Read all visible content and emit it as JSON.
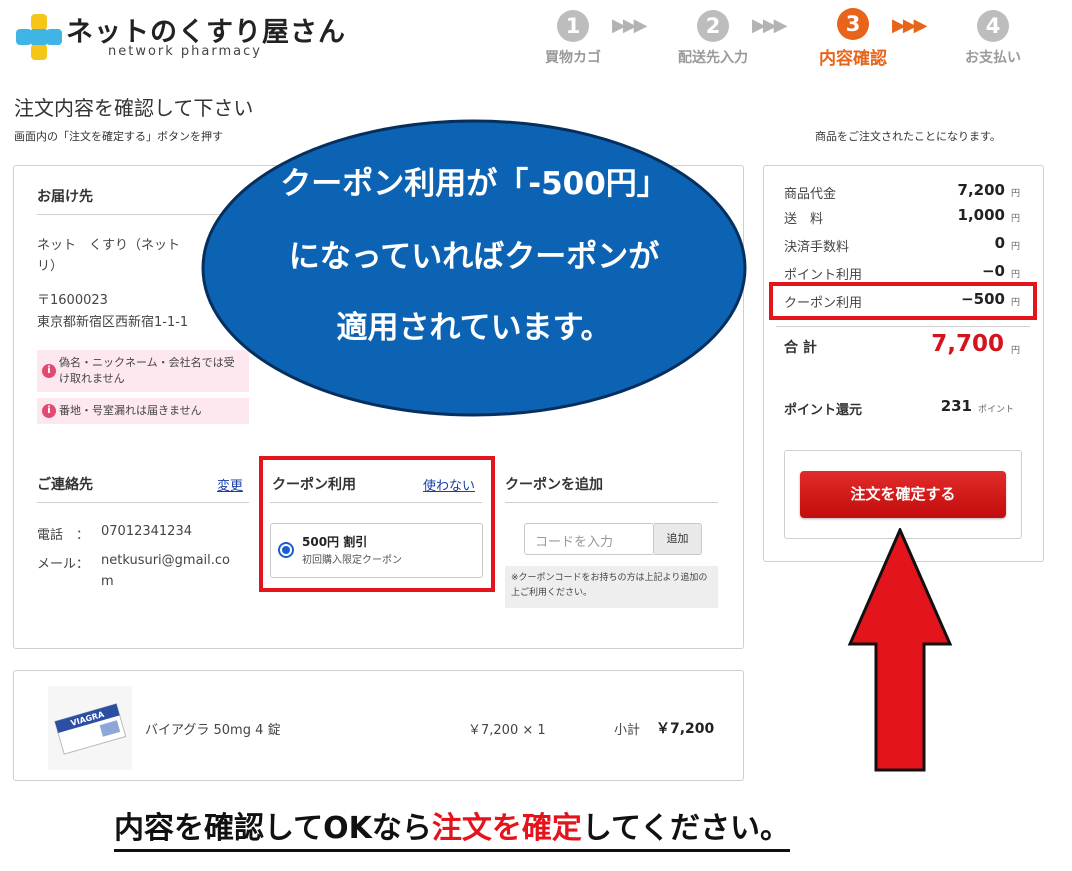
{
  "header": {
    "logo_text": "ネットのくすり屋さん",
    "logo_sub": "network pharmacy",
    "steps": [
      {
        "num": "1",
        "label": "買物カゴ"
      },
      {
        "num": "2",
        "label": "配送先入力"
      },
      {
        "num": "3",
        "label": "内容確認"
      },
      {
        "num": "4",
        "label": "お支払い"
      }
    ],
    "arrow_glyphs": "▶▶▶",
    "active_color": "#e8641a"
  },
  "page": {
    "title": "注文内容を確認して下さい",
    "instruction_start": "画面内の「注文を確定する」ボタンを押す",
    "instruction_end": "商品をご注文されたことになります。"
  },
  "delivery": {
    "title": "お届け先",
    "name": "ネット　くすり（ネット",
    "name_cont": "リ）",
    "postal": "〒1600023",
    "address": "東京都新宿区西新宿1-1-1",
    "warning1": "偽名・ニックネーム・会社名では受け取れません",
    "warning2": "番地・号室漏れは届きません"
  },
  "contact": {
    "title": "ご連絡先",
    "change_link": "変更",
    "phone_label": "電話　：",
    "phone": "07012341234",
    "mail_label": "メール：",
    "mail_line1": "netkusuri@gmail.co",
    "mail_line2": "m"
  },
  "coupon": {
    "title": "クーポン利用",
    "no_use_link": "使わない",
    "option_title": "500円 割引",
    "option_sub": "初回購入限定クーポン"
  },
  "coupon_add": {
    "title": "クーポンを追加",
    "placeholder": "コードを入力",
    "add_label": "追加",
    "note": "※クーポンコードをお持ちの方は上記より追加の上ご利用ください。"
  },
  "summary": {
    "rows": [
      {
        "label": "商品代金",
        "value": "7,200",
        "unit": "円"
      },
      {
        "label": "送　料",
        "value": "1,000",
        "unit": "円"
      },
      {
        "label": "決済手数料",
        "value": "0",
        "unit": "円"
      },
      {
        "label": "ポイント利用",
        "value": "−0",
        "unit": "円"
      },
      {
        "label": "クーポン利用",
        "value": "−500",
        "unit": "円"
      }
    ],
    "total_label": "合 計",
    "total_value": "7,700",
    "total_unit": "円",
    "points_label": "ポイント還元",
    "points_value": "231",
    "points_unit": "ポイント",
    "confirm_label": "注文を確定する"
  },
  "product": {
    "name": "バイアグラ 50mg 4 錠",
    "price_qty": "￥7,200 × 1",
    "subtotal_label": "小計",
    "subtotal_value": "￥7,200",
    "package_text": "VIAGRA"
  },
  "callout": {
    "line1": "クーポン利用が「-500円」",
    "line2": "になっていればクーポンが",
    "line3": "適用されています。"
  },
  "bottom": {
    "pre": "内容を確認してOKなら",
    "highlight": "注文を確定",
    "post": "してください。"
  },
  "colors": {
    "accent": "#e8641a",
    "annotation_red": "#e3141c",
    "bubble_blue": "#0d63b3"
  }
}
